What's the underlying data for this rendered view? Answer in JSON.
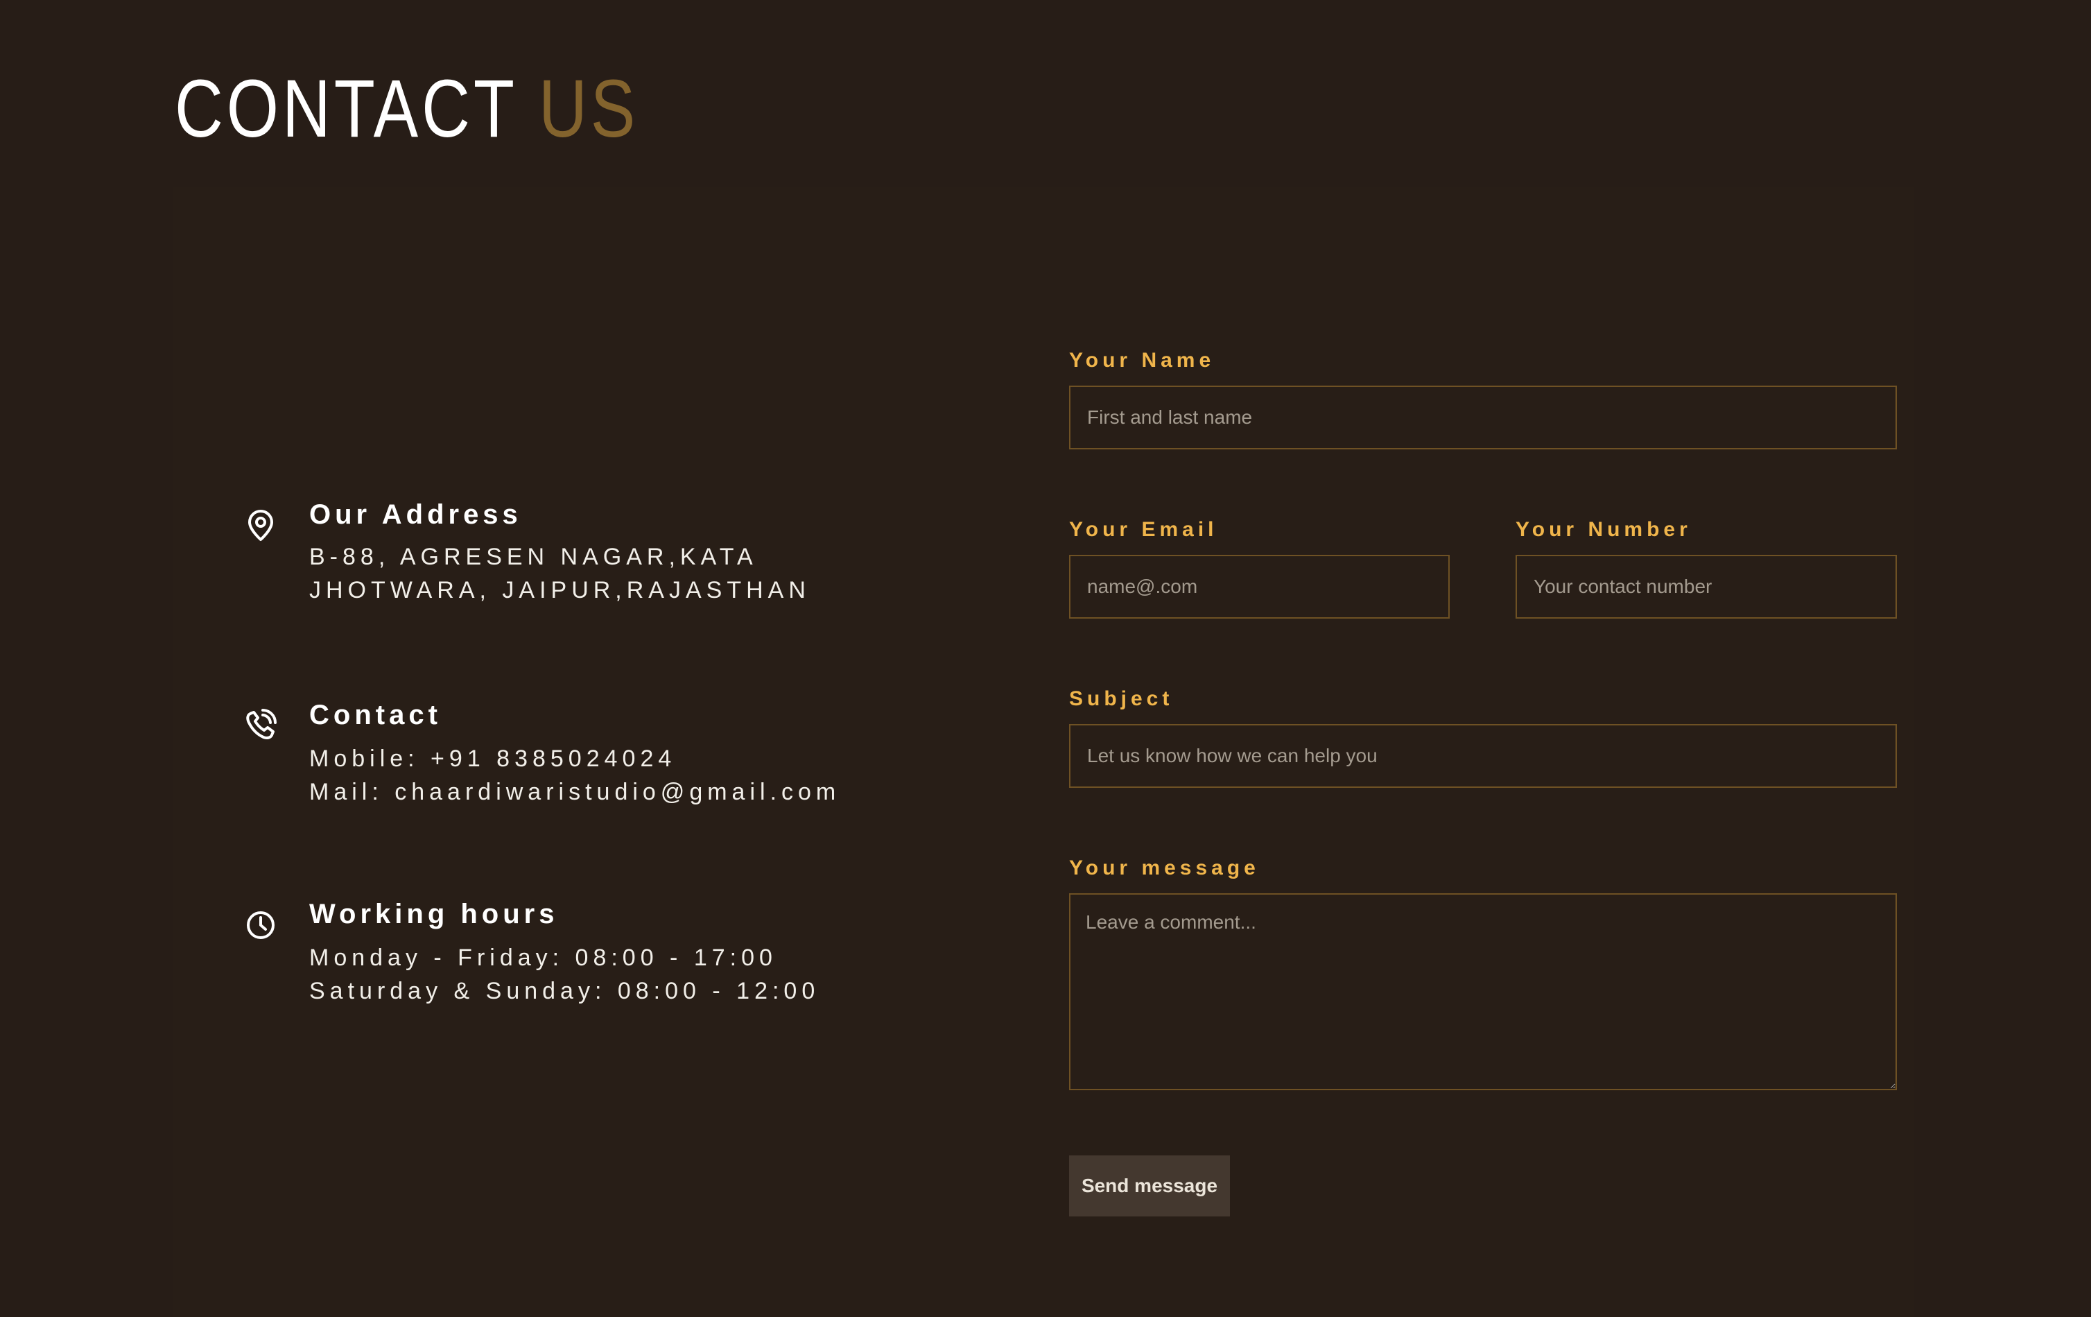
{
  "title": {
    "main": "CONTACT",
    "accent": "US"
  },
  "info": {
    "address": {
      "icon": "location-pin-icon",
      "heading": "Our Address",
      "lines": [
        "B-88, AGRESEN NAGAR,KATA",
        "JHOTWARA, JAIPUR,RAJASTHAN"
      ]
    },
    "contact": {
      "icon": "phone-icon",
      "heading": "Contact",
      "lines": [
        "Mobile: +91 8385024024",
        "Mail: chaardiwaristudio@gmail.com"
      ]
    },
    "hours": {
      "icon": "clock-icon",
      "heading": "Working hours",
      "lines": [
        "Monday - Friday: 08:00 - 17:00",
        "Saturday & Sunday: 08:00 - 12:00"
      ]
    }
  },
  "form": {
    "name": {
      "label": "Your Name",
      "placeholder": "First and last name"
    },
    "email": {
      "label": "Your Email",
      "placeholder": "name@.com"
    },
    "number": {
      "label": "Your Number",
      "placeholder": "Your contact number"
    },
    "subject": {
      "label": "Subject",
      "placeholder": "Let us know how we can help you"
    },
    "message": {
      "label": "Your message",
      "placeholder": "Leave a comment..."
    },
    "submit_label": "Send message"
  },
  "colors": {
    "background": "#271d17",
    "accent_title": "#83632d",
    "label_gold": "#f0b54b",
    "field_border": "#6e5124",
    "button_bg": "#44382f"
  }
}
